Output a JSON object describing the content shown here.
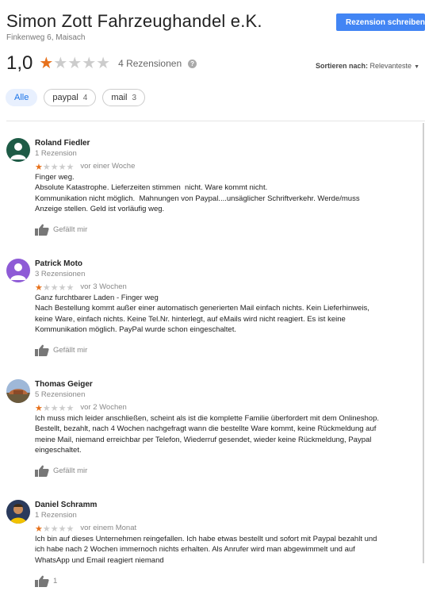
{
  "business": {
    "name": "Simon Zott Fahrzeughandel e.K.",
    "address": "Finkenweg 6, Maisach",
    "write_review_label": "Rezension schreiben"
  },
  "summary": {
    "rating": "1,0",
    "stars_filled": 1,
    "stars_total": 5,
    "review_count_label": "4 Rezensionen"
  },
  "sort": {
    "label": "Sortieren nach:",
    "value": "Relevanteste"
  },
  "filters": [
    {
      "label": "Alle",
      "count": ""
    },
    {
      "label": "paypal",
      "count": "4"
    },
    {
      "label": "mail",
      "count": "3"
    }
  ],
  "reviews": [
    {
      "name": "Roland Fiedler",
      "count": "1 Rezension",
      "stars": 1,
      "time": "vor einer Woche",
      "text": [
        "Finger weg.",
        "Absolute Katastrophe. Lieferzeiten stimmen  nicht. Ware kommt nicht.",
        "Kommunikation nicht möglich.  Mahnungen von Paypal....unsäglicher Schriftverkehr. Werde/muss",
        "Anzeige stellen. Geld ist vorläufig weg."
      ],
      "like": "Gefällt mir",
      "avatar_color": "#1e5b46"
    },
    {
      "name": "Patrick Moto",
      "count": "3 Rezensionen",
      "stars": 1,
      "time": "vor 3 Wochen",
      "text": [
        "Ganz furchtbarer Laden - Finger weg",
        "Nach Bestellung kommt außer einer automatisch generierten Mail einfach nichts. Kein Lieferhinweis,",
        "keine Ware, einfach nichts. Keine Tel.Nr. hinterlegt, auf eMails wird nicht reagiert. Es ist keine",
        "Kommunikation möglich. PayPal wurde schon eingeschaltet."
      ],
      "like": "Gefällt mir",
      "avatar_color": "#8e5bd6"
    },
    {
      "name": "Thomas Geiger",
      "count": "5 Rezensionen",
      "stars": 1,
      "time": "vor 2 Wochen",
      "text": [
        "Ich muss mich leider anschließen, scheint als ist die komplette Familie überfordert mit dem Onlineshop.",
        "Bestellt, bezahlt, nach 4 Wochen nachgefragt wann die bestellte Ware kommt, keine Rückmeldung auf",
        "meine Mail, niemand erreichbar per Telefon, Wiederruf gesendet, wieder keine Rückmeldung, Paypal",
        "eingeschaltet."
      ],
      "like": "Gefällt mir",
      "avatar_color": "#b5673a"
    },
    {
      "name": "Daniel Schramm",
      "count": "1 Rezension",
      "stars": 1,
      "time": "vor einem Monat",
      "text": [
        "Ich bin auf dieses Unternehmen reingefallen. Ich habe etwas bestellt und sofort mit Paypal bezahlt und",
        "ich habe nach 2 Wochen immernoch nichts erhalten. Als Anrufer wird man abgewimmelt und auf",
        "WhatsApp und Email reagiert niemand"
      ],
      "like": "1",
      "avatar_color": "#2a3a5c"
    }
  ],
  "colors": {
    "accent": "#4285f4",
    "star_on": "#e7711b",
    "star_off": "#cccccc"
  }
}
